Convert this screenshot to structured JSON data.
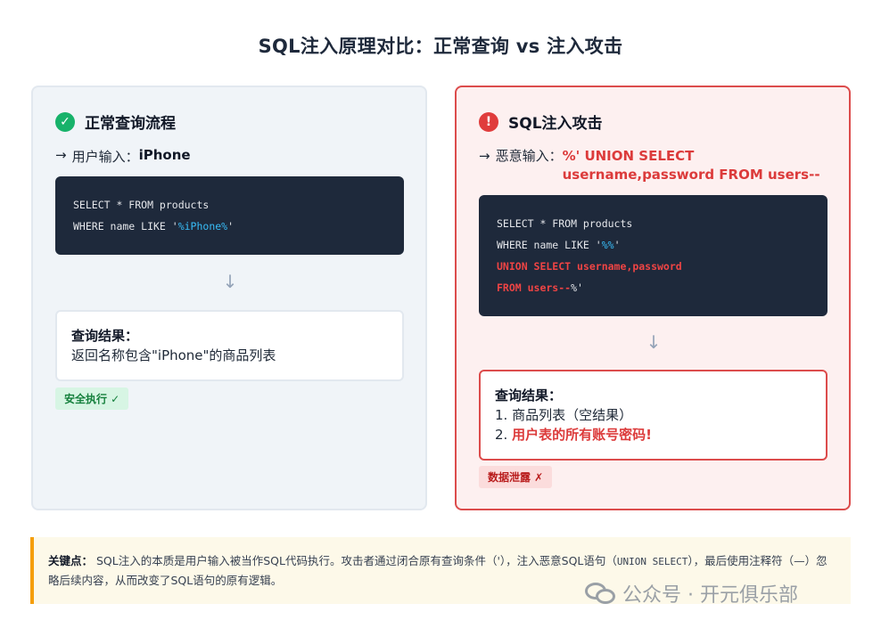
{
  "title": "SQL注入原理对比：正常查询 vs 注入攻击",
  "left": {
    "heading": "正常查询流程",
    "icon": "check-icon",
    "arrow": "→",
    "input_label": "用户输入：",
    "input_value": "iPhone",
    "code": {
      "line1": "SELECT * FROM products",
      "line2_pre": "WHERE name LIKE '",
      "line2_hl": "%iPhone%",
      "line2_post": "'"
    },
    "down_arrow": "↓",
    "result_title": "查询结果：",
    "result_text": "返回名称包含\"iPhone\"的商品列表",
    "badge": "安全执行 ✓"
  },
  "right": {
    "heading": "SQL注入攻击",
    "icon": "alert-icon",
    "arrow": "→",
    "input_label": "恶意输入：",
    "input_value": "%' UNION SELECT username,password FROM users--",
    "code": {
      "line1": "SELECT * FROM products",
      "line2_pre": "WHERE name LIKE '",
      "line2_hl": "%%",
      "line2_post": "'",
      "line3": "UNION SELECT username,password",
      "line4_red": "FROM users--",
      "line4_post": "%'"
    },
    "down_arrow": "↓",
    "result_title": "查询结果：",
    "result_item1": "1. 商品列表（空结果）",
    "result_item2_prefix": "2. ",
    "result_item2": "用户表的所有账号密码!",
    "badge": "数据泄露 ✗"
  },
  "note": {
    "label": "关键点：",
    "text1": "SQL注入的本质是用户输入被当作SQL代码执行。攻击者通过闭合原有查询条件（'），注入恶意SQL语句（",
    "mono": "UNION SELECT",
    "text2": "），最后使用注释符（—）忽略后续内容，从而改变了SQL语句的原有逻辑。"
  },
  "watermark": {
    "icon": "wechat-icon",
    "text": "公众号 · 开元俱乐部"
  },
  "colors": {
    "ok": "#17b26a",
    "bad": "#e03c3c",
    "code_bg": "#1e293b",
    "note_accent": "#f59e0b"
  }
}
